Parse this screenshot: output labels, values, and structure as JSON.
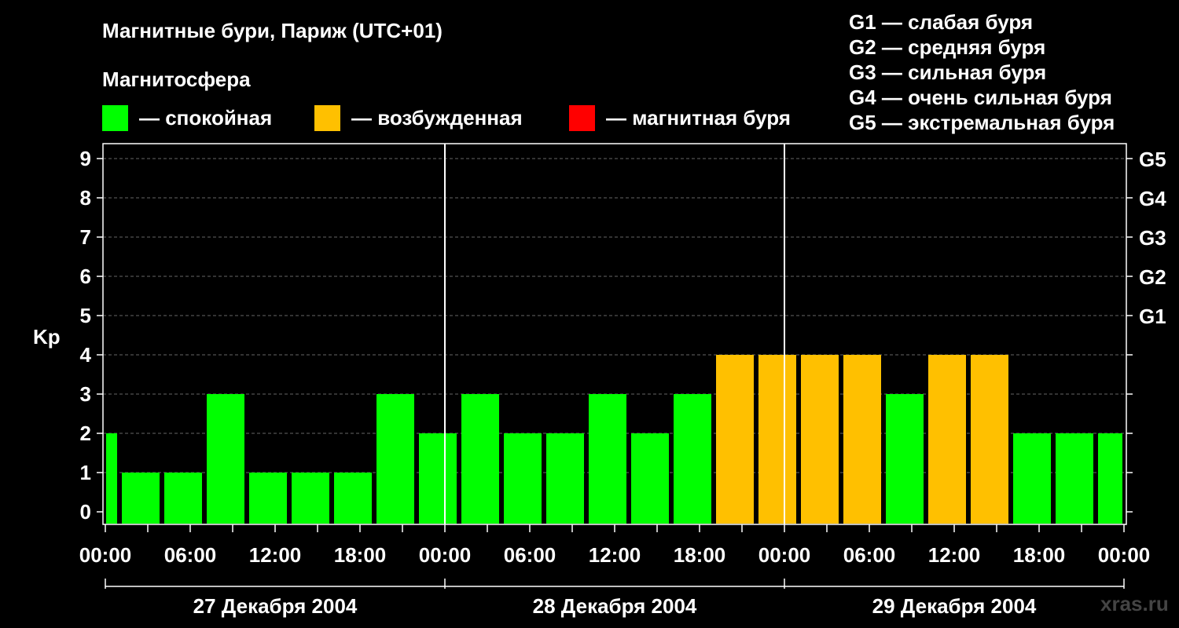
{
  "header": {
    "title": "Магнитные бури, Париж (UTC+01)",
    "subtitle": "Магнитосфера"
  },
  "legend": [
    {
      "label": "— спокойная",
      "color": "#00ff00"
    },
    {
      "label": "— возбужденная",
      "color": "#ffc000"
    },
    {
      "label": "— магнитная буря",
      "color": "#ff0000"
    }
  ],
  "g_legend": [
    "G1 — слабая буря",
    "G2 — средняя буря",
    "G3 — сильная буря",
    "G4 — очень сильная буря",
    "G5 — экстремальная буря"
  ],
  "watermark": "xras.ru",
  "chart_data": {
    "type": "bar",
    "ylabel": "Kp",
    "ylim": [
      0,
      9
    ],
    "y_ticks": [
      "0",
      "1",
      "2",
      "3",
      "4",
      "5",
      "6",
      "7",
      "8",
      "9"
    ],
    "right_ticks": [
      {
        "kp": 5,
        "label": "G1"
      },
      {
        "kp": 6,
        "label": "G2"
      },
      {
        "kp": 7,
        "label": "G3"
      },
      {
        "kp": 8,
        "label": "G4"
      },
      {
        "kp": 9,
        "label": "G5"
      }
    ],
    "x_tick_labels": [
      "00:00",
      "06:00",
      "12:00",
      "18:00",
      "00:00",
      "06:00",
      "12:00",
      "18:00",
      "00:00",
      "06:00",
      "12:00",
      "18:00",
      "00:00"
    ],
    "days": [
      "27 Декабря 2004",
      "28 Декабря 2004",
      "29 Декабря 2004"
    ],
    "grid": true,
    "colors": {
      "quiet": "#00ff00",
      "active": "#ffc000",
      "storm": "#ff0000"
    },
    "bars": [
      {
        "start_h": 0,
        "end_h": 1,
        "kp": 2,
        "state": "quiet"
      },
      {
        "start_h": 1,
        "end_h": 4,
        "kp": 1,
        "state": "quiet"
      },
      {
        "start_h": 4,
        "end_h": 7,
        "kp": 1,
        "state": "quiet"
      },
      {
        "start_h": 7,
        "end_h": 10,
        "kp": 3,
        "state": "quiet"
      },
      {
        "start_h": 10,
        "end_h": 13,
        "kp": 1,
        "state": "quiet"
      },
      {
        "start_h": 13,
        "end_h": 16,
        "kp": 1,
        "state": "quiet"
      },
      {
        "start_h": 16,
        "end_h": 19,
        "kp": 1,
        "state": "quiet"
      },
      {
        "start_h": 19,
        "end_h": 22,
        "kp": 3,
        "state": "quiet"
      },
      {
        "start_h": 22,
        "end_h": 25,
        "kp": 2,
        "state": "quiet"
      },
      {
        "start_h": 25,
        "end_h": 28,
        "kp": 3,
        "state": "quiet"
      },
      {
        "start_h": 28,
        "end_h": 31,
        "kp": 2,
        "state": "quiet"
      },
      {
        "start_h": 31,
        "end_h": 34,
        "kp": 2,
        "state": "quiet"
      },
      {
        "start_h": 34,
        "end_h": 37,
        "kp": 3,
        "state": "quiet"
      },
      {
        "start_h": 37,
        "end_h": 40,
        "kp": 2,
        "state": "quiet"
      },
      {
        "start_h": 40,
        "end_h": 43,
        "kp": 3,
        "state": "quiet"
      },
      {
        "start_h": 43,
        "end_h": 46,
        "kp": 4,
        "state": "active"
      },
      {
        "start_h": 46,
        "end_h": 49,
        "kp": 4,
        "state": "active"
      },
      {
        "start_h": 49,
        "end_h": 52,
        "kp": 4,
        "state": "active"
      },
      {
        "start_h": 52,
        "end_h": 55,
        "kp": 4,
        "state": "active"
      },
      {
        "start_h": 55,
        "end_h": 58,
        "kp": 3,
        "state": "quiet"
      },
      {
        "start_h": 58,
        "end_h": 61,
        "kp": 4,
        "state": "active"
      },
      {
        "start_h": 61,
        "end_h": 64,
        "kp": 4,
        "state": "active"
      },
      {
        "start_h": 64,
        "end_h": 67,
        "kp": 2,
        "state": "quiet"
      },
      {
        "start_h": 67,
        "end_h": 70,
        "kp": 2,
        "state": "quiet"
      },
      {
        "start_h": 70,
        "end_h": 72,
        "kp": 2,
        "state": "quiet"
      }
    ]
  }
}
